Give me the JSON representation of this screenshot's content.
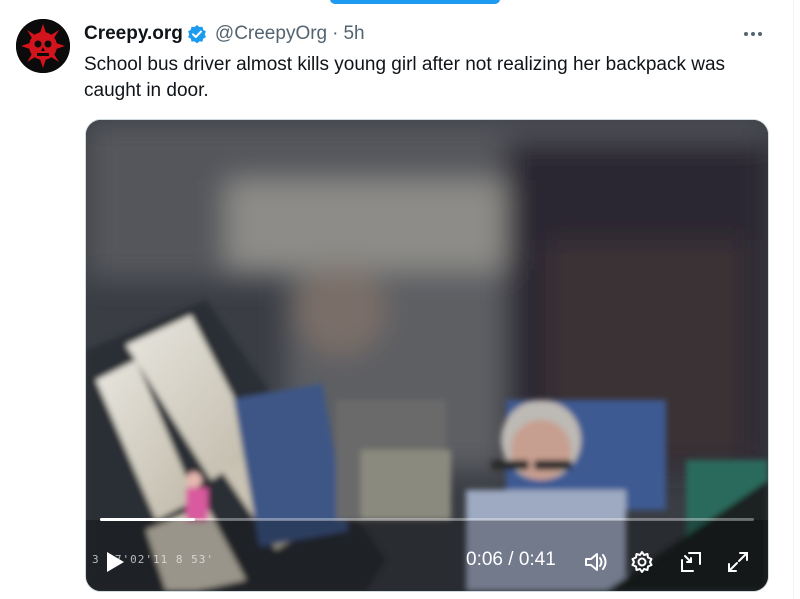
{
  "post": {
    "author": {
      "display_name": "Creepy.org",
      "handle": "@CreepyOrg",
      "avatar_icon": "red-skull-sun-icon",
      "verified": true
    },
    "separator": "·",
    "time_ago": "5h",
    "text": "School bus driver almost kills young girl after not realizing her backpack was caught in door.",
    "more_icon": "more-horizontal-icon"
  },
  "video": {
    "current_time": "0:06",
    "duration": "0:41",
    "time_separator": "/",
    "progress_fraction": 0.146,
    "camera_overlay_text": "3 07'02'11 8 53'",
    "controls": {
      "play_icon": "play-icon",
      "volume_icon": "volume-icon",
      "settings_icon": "gear-icon",
      "pip_icon": "picture-in-picture-icon",
      "fullscreen_icon": "expand-icon"
    }
  },
  "colors": {
    "accent": "#1d9bf0",
    "text": "#0f1419",
    "secondary": "#536471",
    "skull_red": "#d4141c"
  }
}
